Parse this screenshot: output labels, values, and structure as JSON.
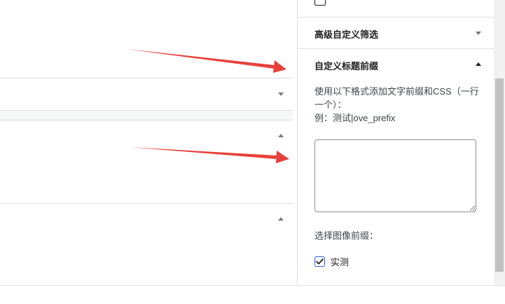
{
  "sidebar": {
    "partial_checkbox_label": "",
    "panels": [
      {
        "title": "高级自定义筛选",
        "expanded": false
      },
      {
        "title": "自定义标题前缀",
        "expanded": true
      }
    ],
    "help_text": "使用以下格式添加文字前缀和CSS（一行一个）：",
    "example_text": "例：测试|ove_prefix",
    "prefix_textarea_value": "",
    "image_prefix_label": "选择图像前缀：",
    "checkbox": {
      "label": "实测",
      "checked": true
    }
  },
  "colors": {
    "arrow": "#e8403a",
    "checkbox_accent": "#3858e9"
  }
}
